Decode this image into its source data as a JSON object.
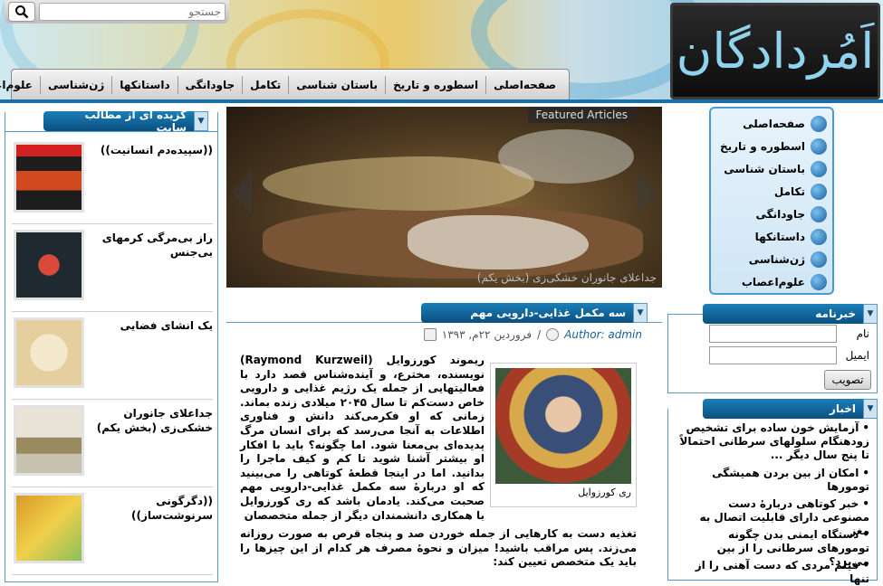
{
  "header": {
    "logo_text": "اَمُردادگان",
    "search_placeholder": "جستجو",
    "search_icon": "search-icon"
  },
  "nav": {
    "items": [
      "صفحه‌اصلی",
      "اسطوره و تاریخ",
      "باستان شناسی",
      "تکامل",
      "جاودانگی",
      "داستانکها",
      "ژن‌شناسی",
      "علوم‌اعصاب"
    ]
  },
  "side_menu": {
    "items": [
      {
        "label": "صفحه‌اصلی",
        "icon": "brain-icon"
      },
      {
        "label": "اسطوره و تاریخ",
        "icon": "symbol-icon"
      },
      {
        "label": "باستان شناسی",
        "icon": "jar-icon"
      },
      {
        "label": "تکامل",
        "icon": "spiral-icon"
      },
      {
        "label": "جاودانگی",
        "icon": "lotus-icon"
      },
      {
        "label": "داستانکها",
        "icon": "quill-icon"
      },
      {
        "label": "ژن‌شناسی",
        "icon": "dna-icon"
      },
      {
        "label": "علوم‌اعصاب",
        "icon": "head-icon"
      }
    ]
  },
  "featured_list": {
    "title": "گزیده ای از مطالب سایت",
    "items": [
      {
        "title": "((سپیده‌دم انسانیت))"
      },
      {
        "title": "راز بی‌مرگی کرمهای بی‌جنس"
      },
      {
        "title": "یک انشای فضایی"
      },
      {
        "title": "جداعلای جانوران خشکی‌زی (بخش یکم)"
      },
      {
        "title": "((دگرگونی سرنوشت‌ساز))"
      }
    ]
  },
  "slider": {
    "badge": "Featured Articles",
    "caption": "جداعلای جانوران خشکی‌زی (بخش یکم)"
  },
  "article": {
    "title": "سه مکمل غذایی-دارویی مهم",
    "date": "فروردین ۲۲م, ۱۳۹۳",
    "separator": "/",
    "author": "Author: admin",
    "photo_caption": "ری کورزوایل",
    "body_side": "ریموند کورزوایل (Raymond Kurzweil) نویسنده، مخترع، و آینده‌شناس قصد دارد با فعالیتهایی از جمله یک رژیم غذایی و دارویی خاص دست‌کم تا سال ۲۰۴۵ میلادی زنده بماند. زمانی که او فکرمی‌کند دانش و فناوری اطلاعات به آنجا می‌رسد که برای انسان مرگ پدیده‌ای بی‌معنا شود. اما چگونه؟ باید با افکار او بیشتر آشنا شوید تا کم و کیف ماجرا را بدانید. اما در اینجا قطعهٔ کوتاهی را می‌بینید که او دربارهٔ سه مکمل غذایی-دارویی مهم صحبت می‌کند. یادمان باشد که ری کورزوایل با همکاری دانشمندان دیگر از جمله متخصصان",
    "body_full": "تغذیه دست به کارهایی از جمله خوردن صد و پنجاه قرص به صورت روزانه می‌زند. پس مراقب باشید! میزان و نحوهٔ مصرف هر کدام از این چیزها را باید یک متخصص تعیین کند:"
  },
  "newsletter": {
    "title": "خبرنامه",
    "name_label": "نام",
    "email_label": "ایمیل",
    "submit_label": "تصویب"
  },
  "news": {
    "title": "اخبار",
    "items": [
      "آزمایش خون ساده برای تشخیص زودهنگام سلولهای سرطانی احتمالاً تا پنج سال دیگر ...",
      "امکان از بین بردن همیشگی تومورها",
      "خبر کوتاهی دربارهٔ دست مصنوعی دارای قابلیت اتصال به مغز",
      "دستگاه ایمنی بدن چگونه تومورهای سرطانی را از بین می‌برد؟",
      "فیلم مردی که دست آهنی را از تنها"
    ]
  },
  "colors": {
    "accent_blue": "#0b4f80",
    "border_blue": "#5a98c8",
    "logo_bg": "#111111",
    "logo_text": "#8fd3ee"
  }
}
